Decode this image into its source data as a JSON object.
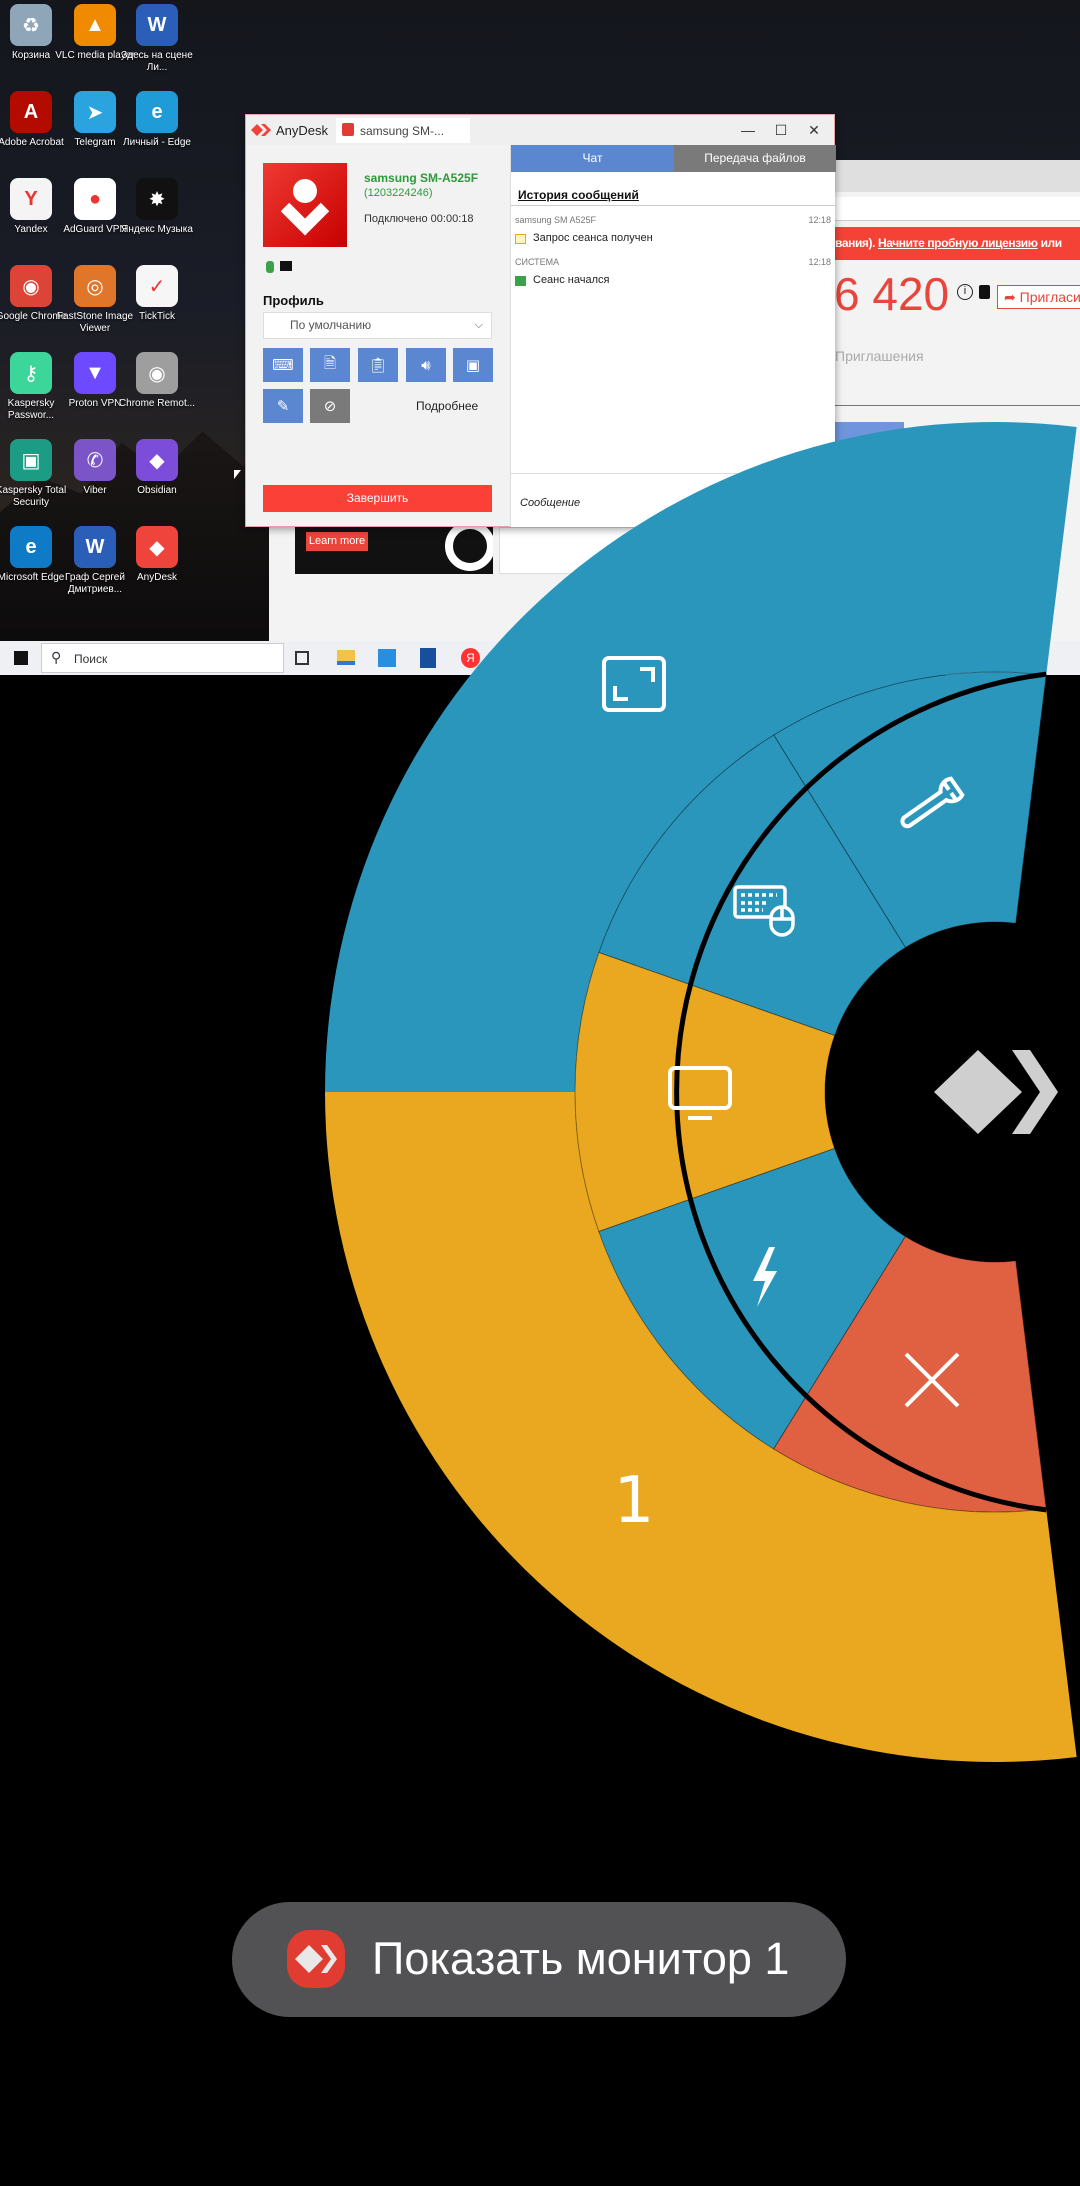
{
  "desktop_icons": [
    {
      "label": "Корзина",
      "icon": "recycle-bin-icon",
      "color": "#8fa6b8",
      "glyph": "♻"
    },
    {
      "label": "VLC media player",
      "icon": "vlc-icon",
      "color": "#f08a00",
      "glyph": "▲"
    },
    {
      "label": "Здесь на сцене Ли...",
      "icon": "word-doc-icon",
      "color": "#2b5eb8",
      "glyph": "W"
    },
    {
      "label": "Adobe Acrobat",
      "icon": "acrobat-icon",
      "color": "#b30b00",
      "glyph": "A"
    },
    {
      "label": "Telegram",
      "icon": "telegram-icon",
      "color": "#2aa3df",
      "glyph": "➤"
    },
    {
      "label": "Личный - Edge",
      "icon": "edge-icon",
      "color": "#1f9bd8",
      "glyph": "e"
    },
    {
      "label": "Yandex",
      "icon": "yandex-browser-icon",
      "color": "#f4f4f4",
      "glyph": "Y"
    },
    {
      "label": "AdGuard VPN",
      "icon": "adguard-icon",
      "color": "#ffffff",
      "glyph": "●"
    },
    {
      "label": "Яндекс Музыка",
      "icon": "yandex-music-icon",
      "color": "#111111",
      "glyph": "✸"
    },
    {
      "label": "Google Chrome",
      "icon": "chrome-icon",
      "color": "#db4437",
      "glyph": "◉"
    },
    {
      "label": "FastStone Image Viewer",
      "icon": "faststone-icon",
      "color": "#e0762a",
      "glyph": "◎"
    },
    {
      "label": "TickTick",
      "icon": "ticktick-icon",
      "color": "#f6f6f6",
      "glyph": "✓"
    },
    {
      "label": "Kaspersky Passwor...",
      "icon": "kaspersky-password-icon",
      "color": "#3cd59a",
      "glyph": "⚷"
    },
    {
      "label": "Proton VPN",
      "icon": "proton-vpn-icon",
      "color": "#6d4aff",
      "glyph": "▼"
    },
    {
      "label": "Chrome Remot...",
      "icon": "chrome-remote-icon",
      "color": "#9e9e9e",
      "glyph": "◉"
    },
    {
      "label": "Kaspersky Total Security",
      "icon": "kaspersky-icon",
      "color": "#1c9c84",
      "glyph": "▣"
    },
    {
      "label": "Viber",
      "icon": "viber-icon",
      "color": "#7b55c7",
      "glyph": "✆"
    },
    {
      "label": "Obsidian",
      "icon": "obsidian-icon",
      "color": "#7c4dd8",
      "glyph": "◆"
    },
    {
      "label": "Microsoft Edge",
      "icon": "edge-icon",
      "color": "#0f7ac6",
      "glyph": "e"
    },
    {
      "label": "Граф Сергей Дмитриев...",
      "icon": "word-doc-icon",
      "color": "#2b5eb8",
      "glyph": "W"
    },
    {
      "label": "AnyDesk",
      "icon": "anydesk-icon",
      "color": "#ef443b",
      "glyph": "◆"
    }
  ],
  "anydesk": {
    "app_name": "AnyDesk",
    "tab_title": "samsung SM-...",
    "device_name": "samsung SM-A525F",
    "device_id": "(1203224246)",
    "connected": "Подключено 00:00:18",
    "profile_label": "Профиль",
    "profile_value": "По умолчанию",
    "more_label": "Подробнее",
    "end_button": "Завершить",
    "tabs": [
      {
        "label": "Чат",
        "active": true
      },
      {
        "label": "Передача файлов",
        "active": false
      }
    ],
    "history_title": "История сообщений",
    "messages": [
      {
        "sender": "samsung SM A525F",
        "time": "12:18",
        "text": "Запрос сеанса получен"
      },
      {
        "sender": "СИСТЕМА",
        "time": "12:18",
        "text": "Сеанс начался"
      }
    ],
    "message_placeholder": "Сообщение",
    "accent": "#ef443b"
  },
  "browser": {
    "banner_text": "вания).",
    "banner_link": "Начните пробную лицензию",
    "banner_tail": "или",
    "id_partial": "6 420",
    "invite_button": "Приглаcи",
    "invites_label": "Приглашения",
    "ad_button": "Learn more"
  },
  "taskbar": {
    "search_placeholder": "Поиск"
  },
  "radial_menu": {
    "outer": [
      {
        "name": "fullscreen",
        "icon": "fullscreen-icon",
        "color": "#2b96bc"
      },
      {
        "name": "monitor",
        "label": "1",
        "color": "#e9a820"
      }
    ],
    "inner": [
      {
        "name": "settings",
        "icon": "wrench-icon",
        "color": "#2b96bc"
      },
      {
        "name": "input",
        "icon": "keyboard-mouse-icon",
        "color": "#2b96bc"
      },
      {
        "name": "display",
        "icon": "monitor-icon",
        "color": "#e9a820"
      },
      {
        "name": "actions",
        "icon": "lightning-icon",
        "color": "#2b96bc"
      },
      {
        "name": "close",
        "icon": "close-icon",
        "color": "#e06042"
      }
    ],
    "center_icon": "anydesk-logo-icon"
  },
  "toast": {
    "text": "Показать монитор 1"
  }
}
